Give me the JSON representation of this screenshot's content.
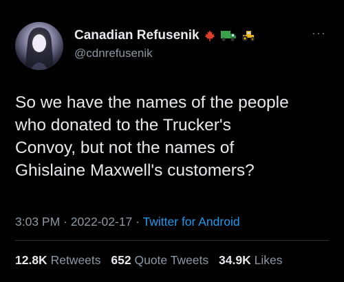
{
  "author": {
    "display_name": "Canadian Refusenik",
    "handle": "@cdnrefusenik",
    "name_emojis": [
      "maple-leaf-icon",
      "truck-icon",
      "tractor-icon"
    ]
  },
  "tweet": {
    "lines": [
      "So we have the names of the people",
      "who donated to the Trucker's",
      "Convoy, but not the names of",
      "Ghislaine Maxwell's customers?"
    ],
    "time": "3:03 PM",
    "date": "2022-02-17",
    "separator": "·",
    "source": "Twitter for Android"
  },
  "stats": {
    "retweets_count": "12.8K",
    "retweets_label": "Retweets",
    "quotes_count": "652",
    "quotes_label": "Quote Tweets",
    "likes_count": "34.9K",
    "likes_label": "Likes"
  },
  "colors": {
    "background": "#000000",
    "text": "#e7e9ea",
    "secondary": "#8b98a5",
    "link": "#1d9bf0",
    "maple_leaf": "#e0402a",
    "truck": "#3aa34a",
    "tractor": "#e8b31c"
  }
}
